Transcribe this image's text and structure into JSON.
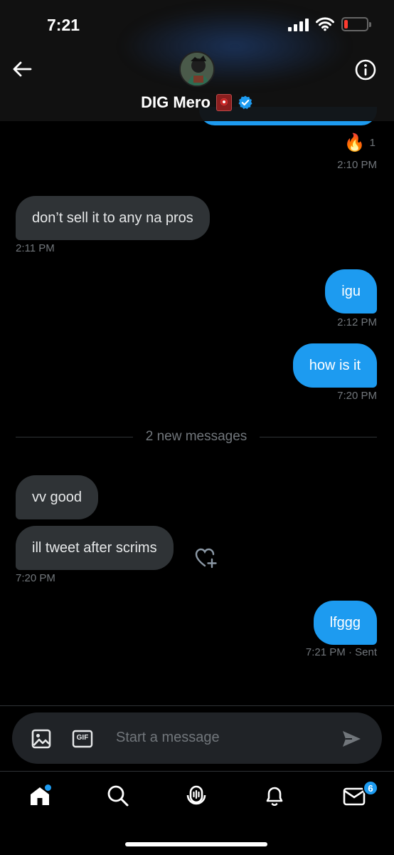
{
  "status_bar": {
    "time": "7:21"
  },
  "header": {
    "name": "DIG Mero"
  },
  "reaction": {
    "emoji": "🔥",
    "count": "1"
  },
  "messages": [
    {
      "side": "out",
      "time": "2:10 PM"
    },
    {
      "side": "in",
      "text": "don’t sell it to any na pros",
      "time": "2:11 PM"
    },
    {
      "side": "out",
      "text": "igu",
      "time": "2:12 PM"
    },
    {
      "side": "out",
      "text": "how is it",
      "time": "7:20 PM"
    },
    {
      "side": "in",
      "text": "vv good"
    },
    {
      "side": "in",
      "text": "ill tweet after scrims",
      "time": "7:20 PM"
    },
    {
      "side": "out",
      "text": "lfggg",
      "time": "7:21 PM",
      "status": "· Sent"
    }
  ],
  "divider": {
    "text": "2 new messages"
  },
  "composer": {
    "placeholder": "Start a message",
    "gif_label": "GIF"
  },
  "tabbar": {
    "messages_badge": "6"
  },
  "colors": {
    "accent": "#1d9bf0",
    "bubble_in": "#2f3336",
    "background": "#000000"
  }
}
